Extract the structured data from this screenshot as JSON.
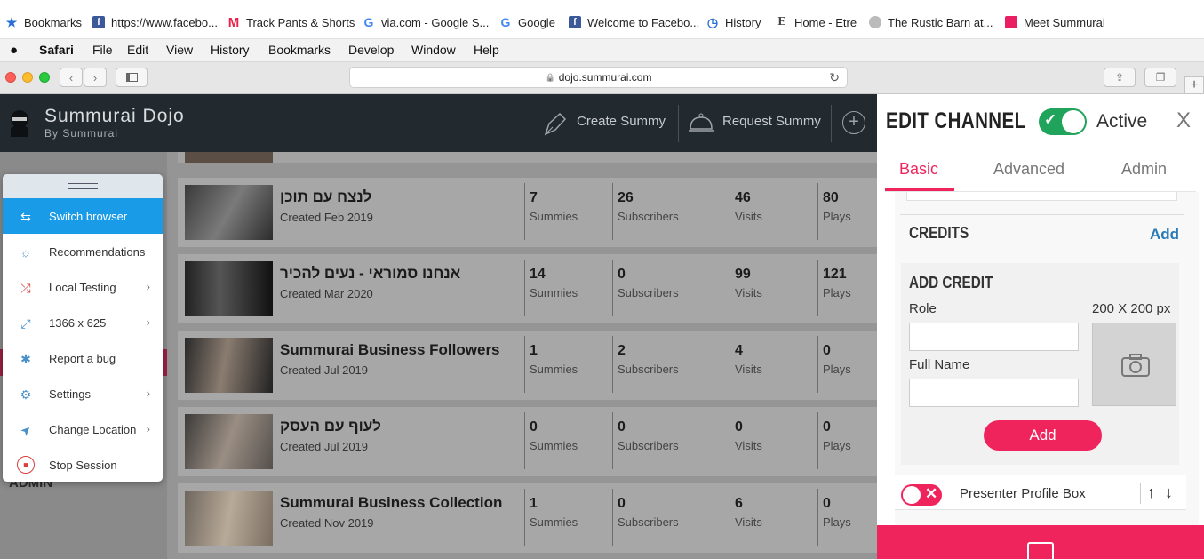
{
  "bookmarks": {
    "items": [
      {
        "label": "Bookmarks",
        "icon": "star-icon",
        "color": "#2a6fd6"
      },
      {
        "label": "https://www.facebo...",
        "icon": "facebook-icon",
        "color": "#3b5998"
      },
      {
        "label": "Track Pants & Shorts",
        "icon": "myntra-icon",
        "color": "#e8234a"
      },
      {
        "label": "via.com - Google S...",
        "icon": "google-icon",
        "color": "#4285f4"
      },
      {
        "label": "Google",
        "icon": "google-icon",
        "color": "#4285f4"
      },
      {
        "label": "Welcome to Facebo...",
        "icon": "facebook-icon",
        "color": "#3b5998"
      },
      {
        "label": "History",
        "icon": "history-icon",
        "color": "#2a6fd6"
      },
      {
        "label": "Home - Etre",
        "icon": "etre-icon",
        "color": "#444"
      },
      {
        "label": "The Rustic Barn at...",
        "icon": "barn-icon",
        "color": "#999"
      },
      {
        "label": "Meet Summurai",
        "icon": "summurai-icon",
        "color": "#e91e63"
      }
    ]
  },
  "menubar": {
    "apple": "",
    "items": [
      "Safari",
      "File",
      "Edit",
      "View",
      "History",
      "Bookmarks",
      "Develop",
      "Window",
      "Help"
    ]
  },
  "toolbar": {
    "url": "dojo.summurai.com",
    "lock": "🔒",
    "reload": "↻",
    "add_tab": "+"
  },
  "site": {
    "brand": "Summurai Dojo",
    "brand_sub": "By Summurai",
    "create_label": "Create Summy",
    "request_label": "Request Summy",
    "add_symbol": "+",
    "admin_label": "ADMIN"
  },
  "channels": [
    {
      "title": "לנצח עם תוכן",
      "created": "Created Feb 2019",
      "summies": "7",
      "subscribers": "26",
      "visits": "46",
      "plays": "80"
    },
    {
      "title": "אנחנו סמוראי - נעים להכיר",
      "created": "Created Mar 2020",
      "summies": "14",
      "subscribers": "0",
      "visits": "99",
      "plays": "121"
    },
    {
      "title": "Summurai Business Followers",
      "created": "Created Jul 2019",
      "summies": "1",
      "subscribers": "2",
      "visits": "4",
      "plays": "0"
    },
    {
      "title": "לעוף עם העסק",
      "created": "Created Jul 2019",
      "summies": "0",
      "subscribers": "0",
      "visits": "0",
      "plays": "0"
    },
    {
      "title": "Summurai Business Collection",
      "created": "Created Nov 2019",
      "summies": "1",
      "subscribers": "0",
      "visits": "6",
      "plays": "0"
    }
  ],
  "stat_labels": {
    "summies": "Summies",
    "subscribers": "Subscribers",
    "visits": "Visits",
    "plays": "Plays"
  },
  "popup": {
    "items": [
      {
        "label": "Switch browser",
        "icon": "switch-icon",
        "glyph": "⇆",
        "chevron": false,
        "active": true
      },
      {
        "label": "Recommendations",
        "icon": "lightbulb-icon",
        "glyph": "☼",
        "chevron": false
      },
      {
        "label": "Local Testing",
        "icon": "shuffle-icon",
        "glyph": "⤮",
        "chevron": true
      },
      {
        "label": "1366 x 625",
        "icon": "resize-icon",
        "glyph": "⤢",
        "chevron": true
      },
      {
        "label": "Report a bug",
        "icon": "bug-icon",
        "glyph": "✱",
        "chevron": false
      },
      {
        "label": "Settings",
        "icon": "gear-icon",
        "glyph": "⚙",
        "chevron": true
      },
      {
        "label": "Change Location",
        "icon": "location-arrow-icon",
        "glyph": "➤",
        "chevron": true
      },
      {
        "label": "Stop Session",
        "icon": "stop-icon",
        "glyph": "■",
        "chevron": false
      }
    ],
    "chevron": "›"
  },
  "panel": {
    "title": "EDIT CHANNEL",
    "active_label": "Active",
    "close": "X",
    "tabs": [
      "Basic",
      "Advanced",
      "Admin"
    ],
    "credits_label": "CREDITS",
    "credits_add": "Add",
    "add_credit_title": "ADD CREDIT",
    "role_label": "Role",
    "full_name_label": "Full Name",
    "image_size": "200 X 200 px",
    "add_button": "Add",
    "presenter_label": "Presenter Profile Box",
    "up": "↑",
    "down": "↓",
    "colors": {
      "accent": "#f0245c",
      "active_green": "#20a35a",
      "tab_active": "#f0245c"
    }
  }
}
